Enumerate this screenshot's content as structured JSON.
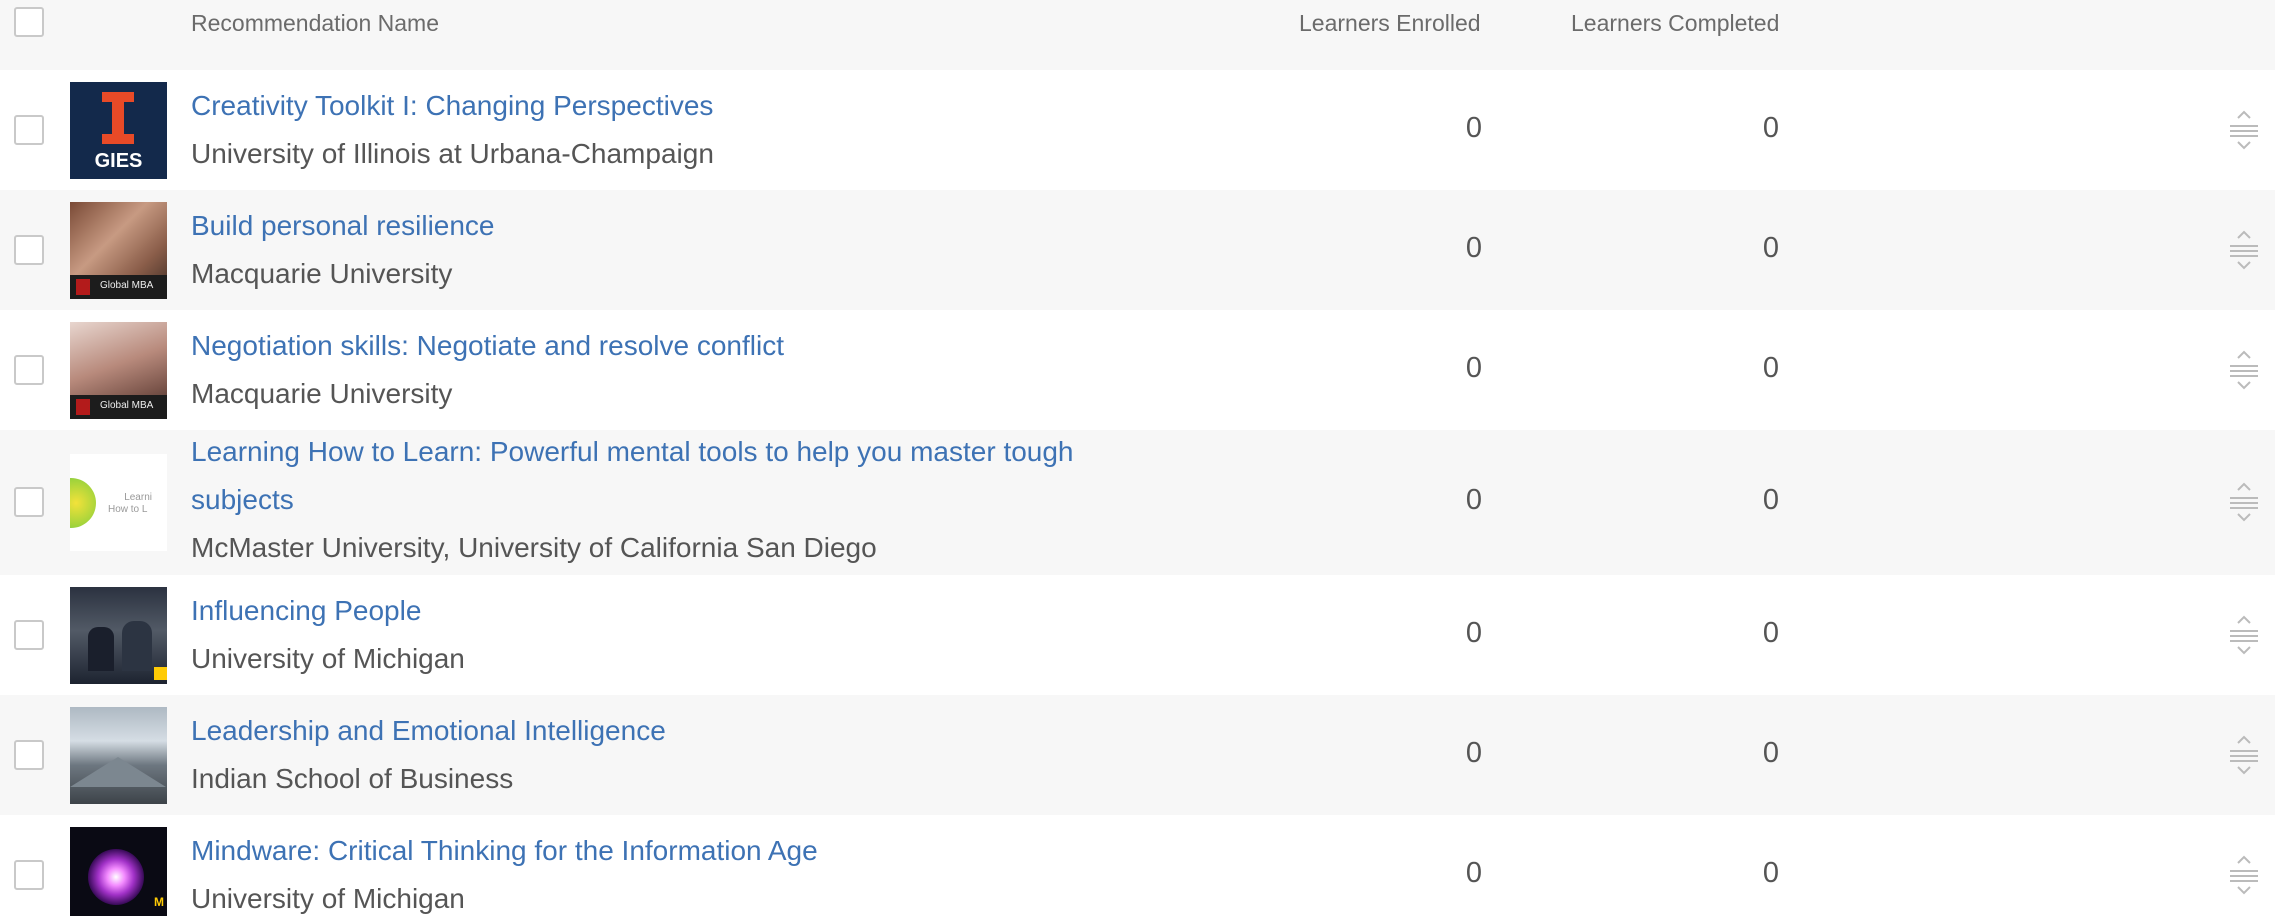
{
  "header": {
    "col_name": "Recommendation Name",
    "col_enrolled": "Learners Enrolled",
    "col_completed": "Learners Completed"
  },
  "rows": [
    {
      "title": "Creativity Toolkit I: Changing Perspectives",
      "provider": "University of Illinois at Urbana-Champaign",
      "enrolled": "0",
      "completed": "0",
      "thumb_text": "GIES"
    },
    {
      "title": "Build personal resilience",
      "provider": "Macquarie University",
      "enrolled": "0",
      "completed": "0",
      "thumb_text": "Global MBA"
    },
    {
      "title": "Negotiation skills: Negotiate and resolve conflict",
      "provider": "Macquarie University",
      "enrolled": "0",
      "completed": "0",
      "thumb_text": "Global MBA"
    },
    {
      "title_line1": "Learning How to Learn: Powerful mental tools to help you master tough",
      "title_line2": "subjects",
      "provider": "McMaster University, University of California San Diego",
      "enrolled": "0",
      "completed": "0",
      "thumb_text_1": "Learni",
      "thumb_text_2": "How to L"
    },
    {
      "title": "Influencing People",
      "provider": "University of Michigan",
      "enrolled": "0",
      "completed": "0"
    },
    {
      "title": "Leadership and Emotional Intelligence",
      "provider": "Indian School of Business",
      "enrolled": "0",
      "completed": "0"
    },
    {
      "title": "Mindware: Critical Thinking for the Information Age",
      "provider": "University of Michigan",
      "enrolled": "0",
      "completed": "0",
      "thumb_text": "M"
    }
  ],
  "icons": {
    "row_checkbox": "checkbox-icon",
    "drag": "drag-handle-icon"
  },
  "colors": {
    "link": "#3d72b4",
    "text": "#555555",
    "row_alt": "#f7f7f7",
    "row": "#ffffff"
  }
}
